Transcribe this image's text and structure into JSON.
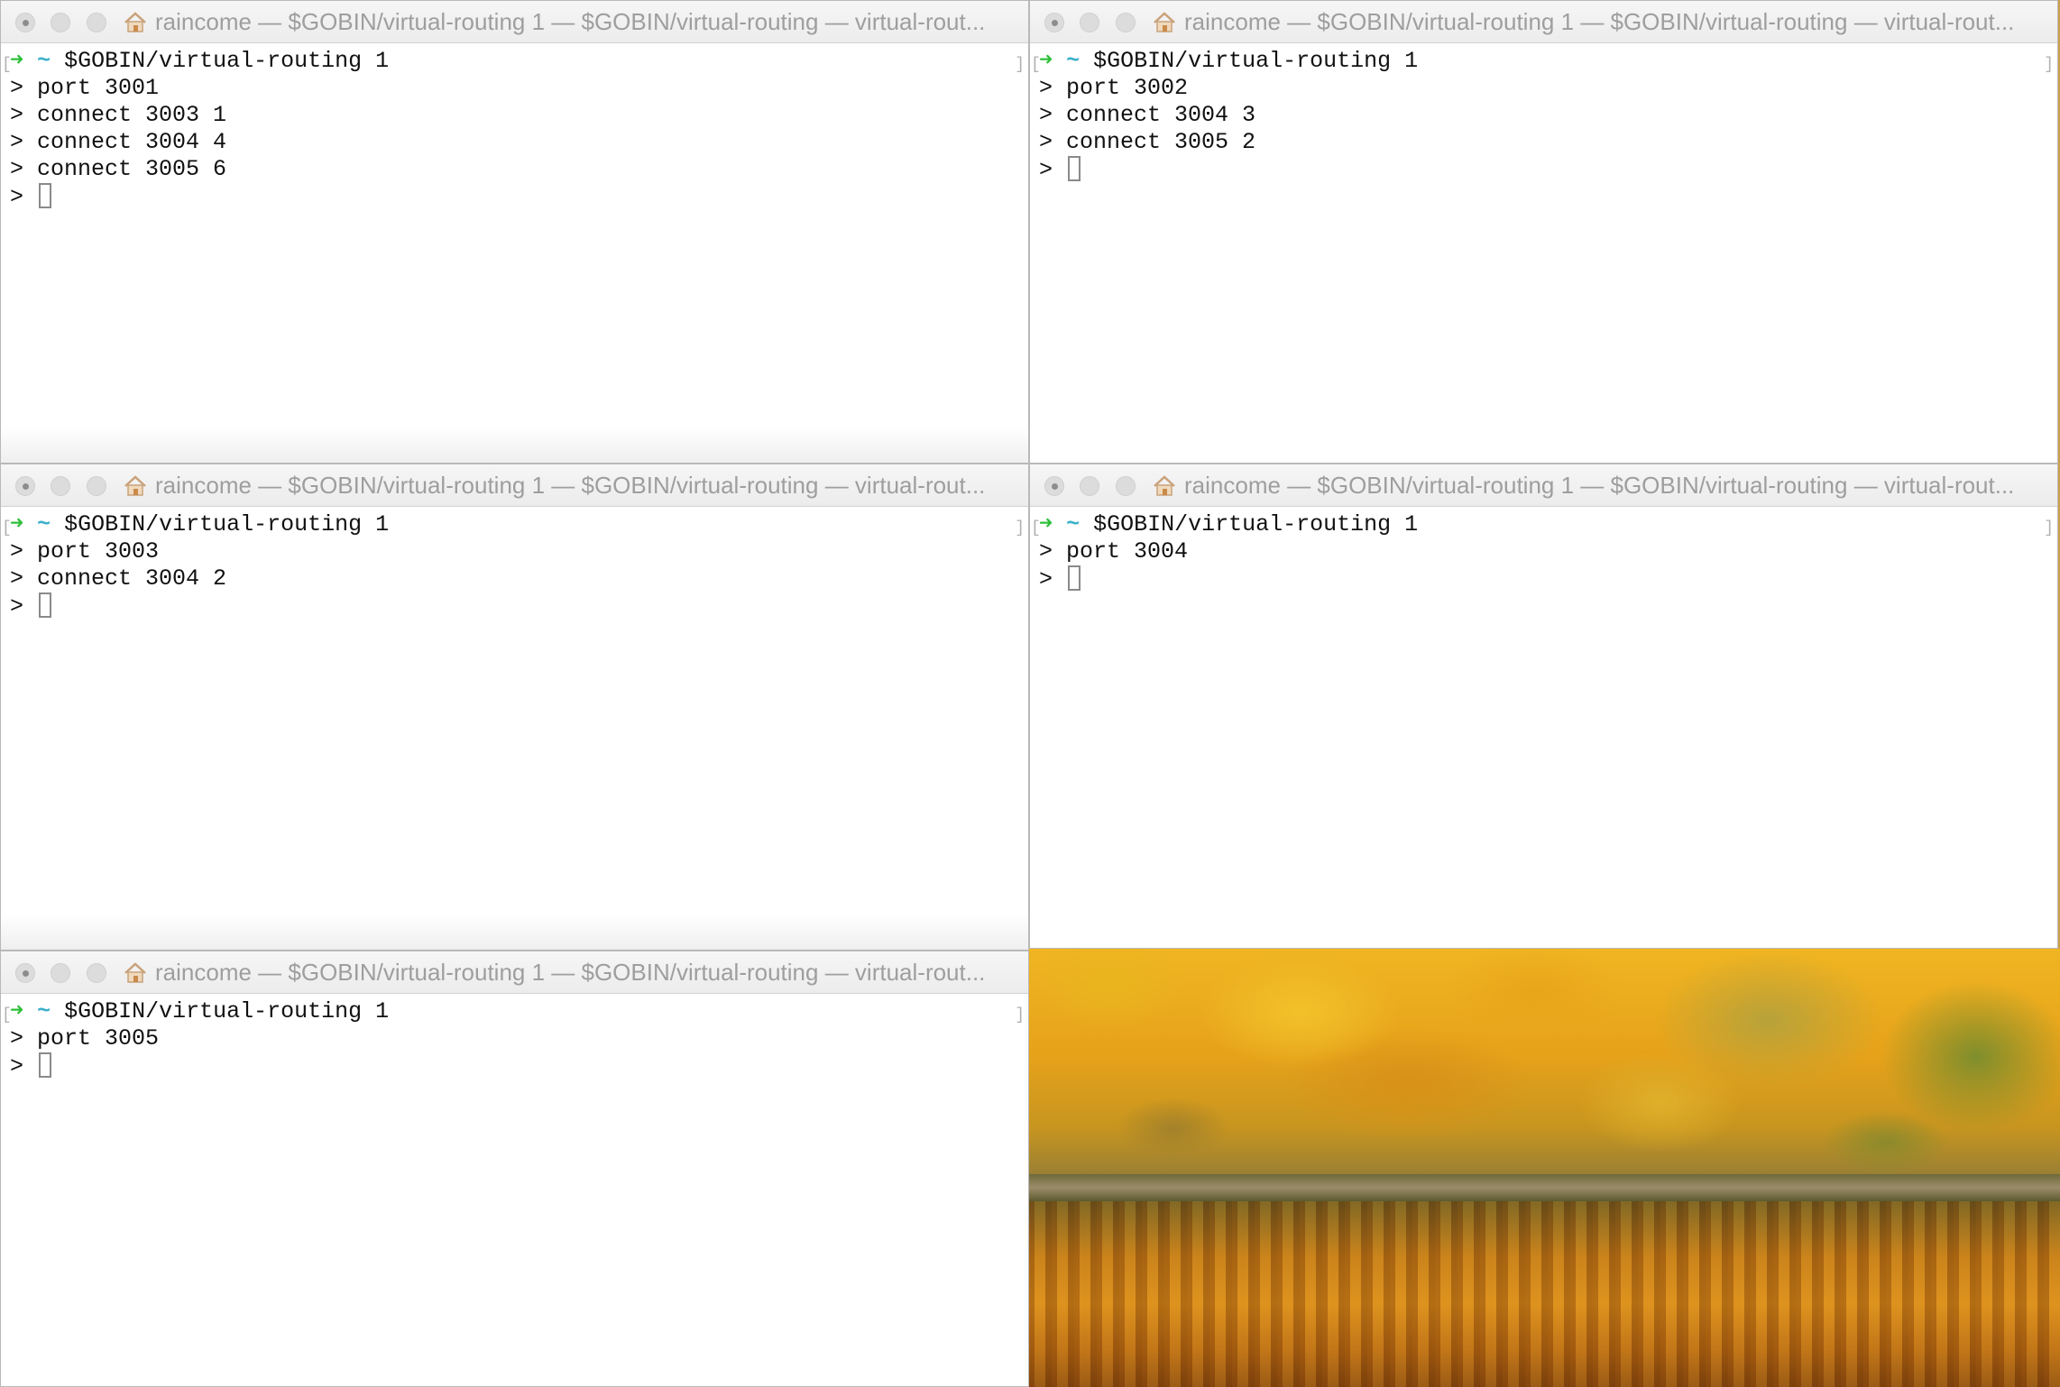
{
  "window_title": "raincome — $GOBIN/virtual-routing 1 — $GOBIN/virtual-routing — virtual-rout...",
  "prompt": {
    "arrow": "➜",
    "tilde": "~",
    "command": " $GOBIN/virtual-routing 1"
  },
  "terminals": [
    {
      "lines": [
        "> port 3001",
        "> connect 3003 1",
        "> connect 3004 4",
        "> connect 3005 6"
      ],
      "cursor_prefix": "> "
    },
    {
      "lines": [
        "> port 3002",
        "> connect 3004 3",
        "> connect 3005 2"
      ],
      "cursor_prefix": "> "
    },
    {
      "lines": [
        "> port 3003",
        "> connect 3004 2"
      ],
      "cursor_prefix": "> "
    },
    {
      "lines": [
        "> port 3004"
      ],
      "cursor_prefix": "> "
    },
    {
      "lines": [
        "> port 3005"
      ],
      "cursor_prefix": "> "
    }
  ],
  "colors": {
    "prompt_arrow": "#2fbf3a",
    "prompt_tilde": "#3bb0c9",
    "title_text": "#9e9e9e"
  },
  "icons": {
    "title_icon": "home-icon",
    "traffic_lights": [
      "close-icon",
      "minimize-icon",
      "zoom-icon"
    ]
  }
}
